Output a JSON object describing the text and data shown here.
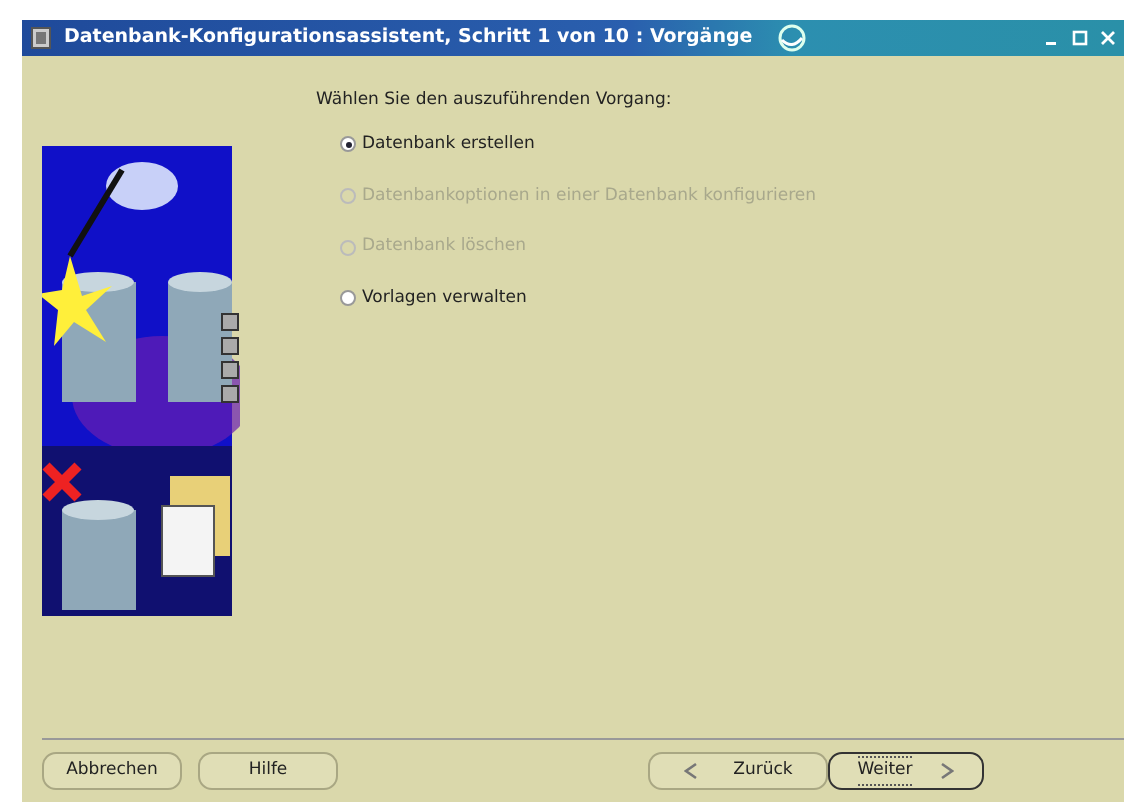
{
  "window": {
    "title": "Datenbank-Konfigurationsassistent, Schritt 1 von 10 : Vorgänge"
  },
  "prompt": "Wählen Sie den auszuführenden Vorgang:",
  "options": [
    {
      "label": "Datenbank erstellen",
      "selected": true,
      "disabled": false
    },
    {
      "label": "Datenbankoptionen in einer Datenbank konfigurieren",
      "selected": false,
      "disabled": true
    },
    {
      "label": "Datenbank löschen",
      "selected": false,
      "disabled": true
    },
    {
      "label": "Vorlagen verwalten",
      "selected": false,
      "disabled": false
    }
  ],
  "buttons": [
    {
      "label": "Abbrechen",
      "kind": "plain",
      "focused": false
    },
    {
      "label": "Hilfe",
      "kind": "plain",
      "focused": false
    },
    {
      "label": "Zurück",
      "kind": "back",
      "focused": false
    },
    {
      "label": "Weiter",
      "kind": "next",
      "focused": true
    }
  ]
}
